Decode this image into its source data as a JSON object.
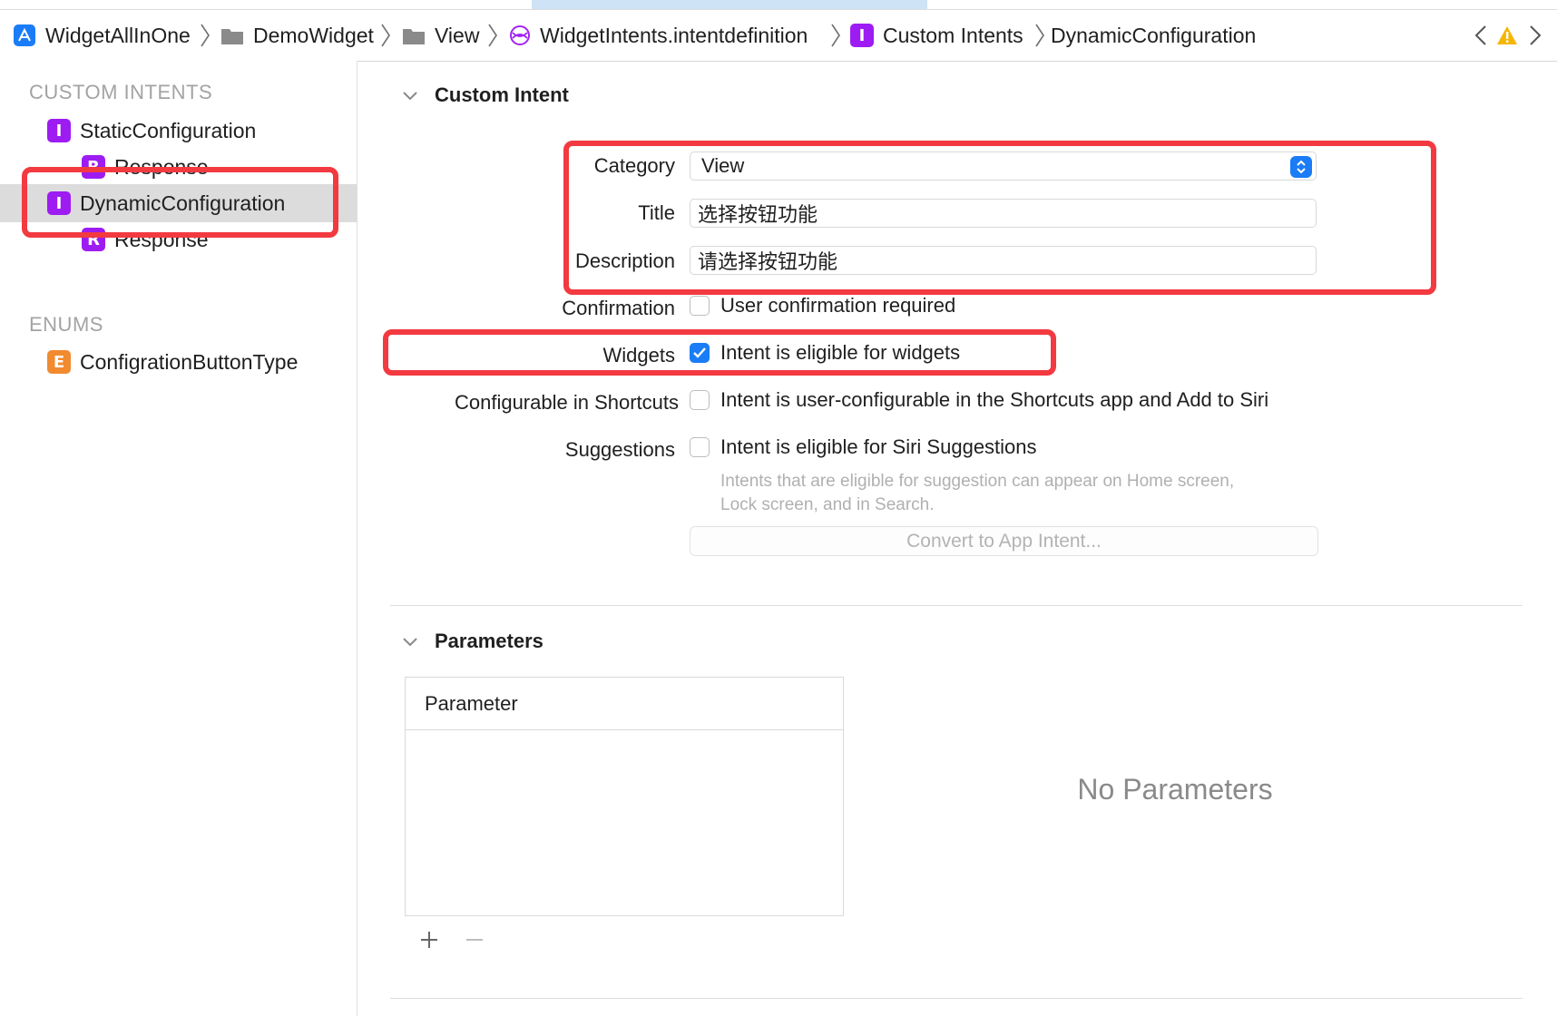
{
  "breadcrumb": [
    {
      "label": "WidgetAllInOne",
      "icon": "xcode-project-icon"
    },
    {
      "label": "DemoWidget",
      "icon": "folder-icon"
    },
    {
      "label": "View",
      "icon": "folder-icon"
    },
    {
      "label": "WidgetIntents.intentdefinition",
      "icon": "intent-definition-icon"
    },
    {
      "label": "Custom Intents",
      "icon": "intent-badge-icon"
    },
    {
      "label": "DynamicConfiguration",
      "icon": ""
    }
  ],
  "badges": {
    "intent": "I",
    "response": "R",
    "enum": "E"
  },
  "sidebar": {
    "custom_intents_header": "CUSTOM INTENTS",
    "enums_header": "ENUMS",
    "intents": [
      {
        "label": "StaticConfiguration",
        "badge": "I"
      },
      {
        "label": "Response",
        "badge": "R"
      },
      {
        "label": "DynamicConfiguration",
        "badge": "I",
        "selected": true
      },
      {
        "label": "Response",
        "badge": "R"
      }
    ],
    "enums": [
      {
        "label": "ConfigrationButtonType",
        "badge": "E"
      }
    ]
  },
  "custom_intent": {
    "section_title": "Custom Intent",
    "category_label": "Category",
    "category_value": "View",
    "title_label": "Title",
    "title_value": "选择按钮功能",
    "description_label": "Description",
    "description_value": "请选择按钮功能",
    "confirmation_label": "Confirmation",
    "confirmation_text": "User confirmation required",
    "confirmation_checked": false,
    "widgets_label": "Widgets",
    "widgets_text": "Intent is eligible for widgets",
    "widgets_checked": true,
    "shortcuts_label": "Configurable in Shortcuts",
    "shortcuts_text": "Intent is user-configurable in the Shortcuts app and Add to Siri",
    "shortcuts_checked": false,
    "suggestions_label": "Suggestions",
    "suggestions_text": "Intent is eligible for Siri Suggestions",
    "suggestions_checked": false,
    "suggestions_help_1": "Intents that are eligible for suggestion can appear on Home screen,",
    "suggestions_help_2": "Lock screen, and in Search.",
    "convert_button": "Convert to App Intent..."
  },
  "parameters": {
    "section_title": "Parameters",
    "column_header": "Parameter",
    "empty_text": "No Parameters",
    "add_symbol": "+",
    "remove_symbol": "−"
  },
  "colors": {
    "accent": "#1a7cf6",
    "intent_badge": "#9d1cf2",
    "enum_badge": "#f28a30",
    "warning": "#f6b600",
    "annotation_red": "#f23a40"
  }
}
